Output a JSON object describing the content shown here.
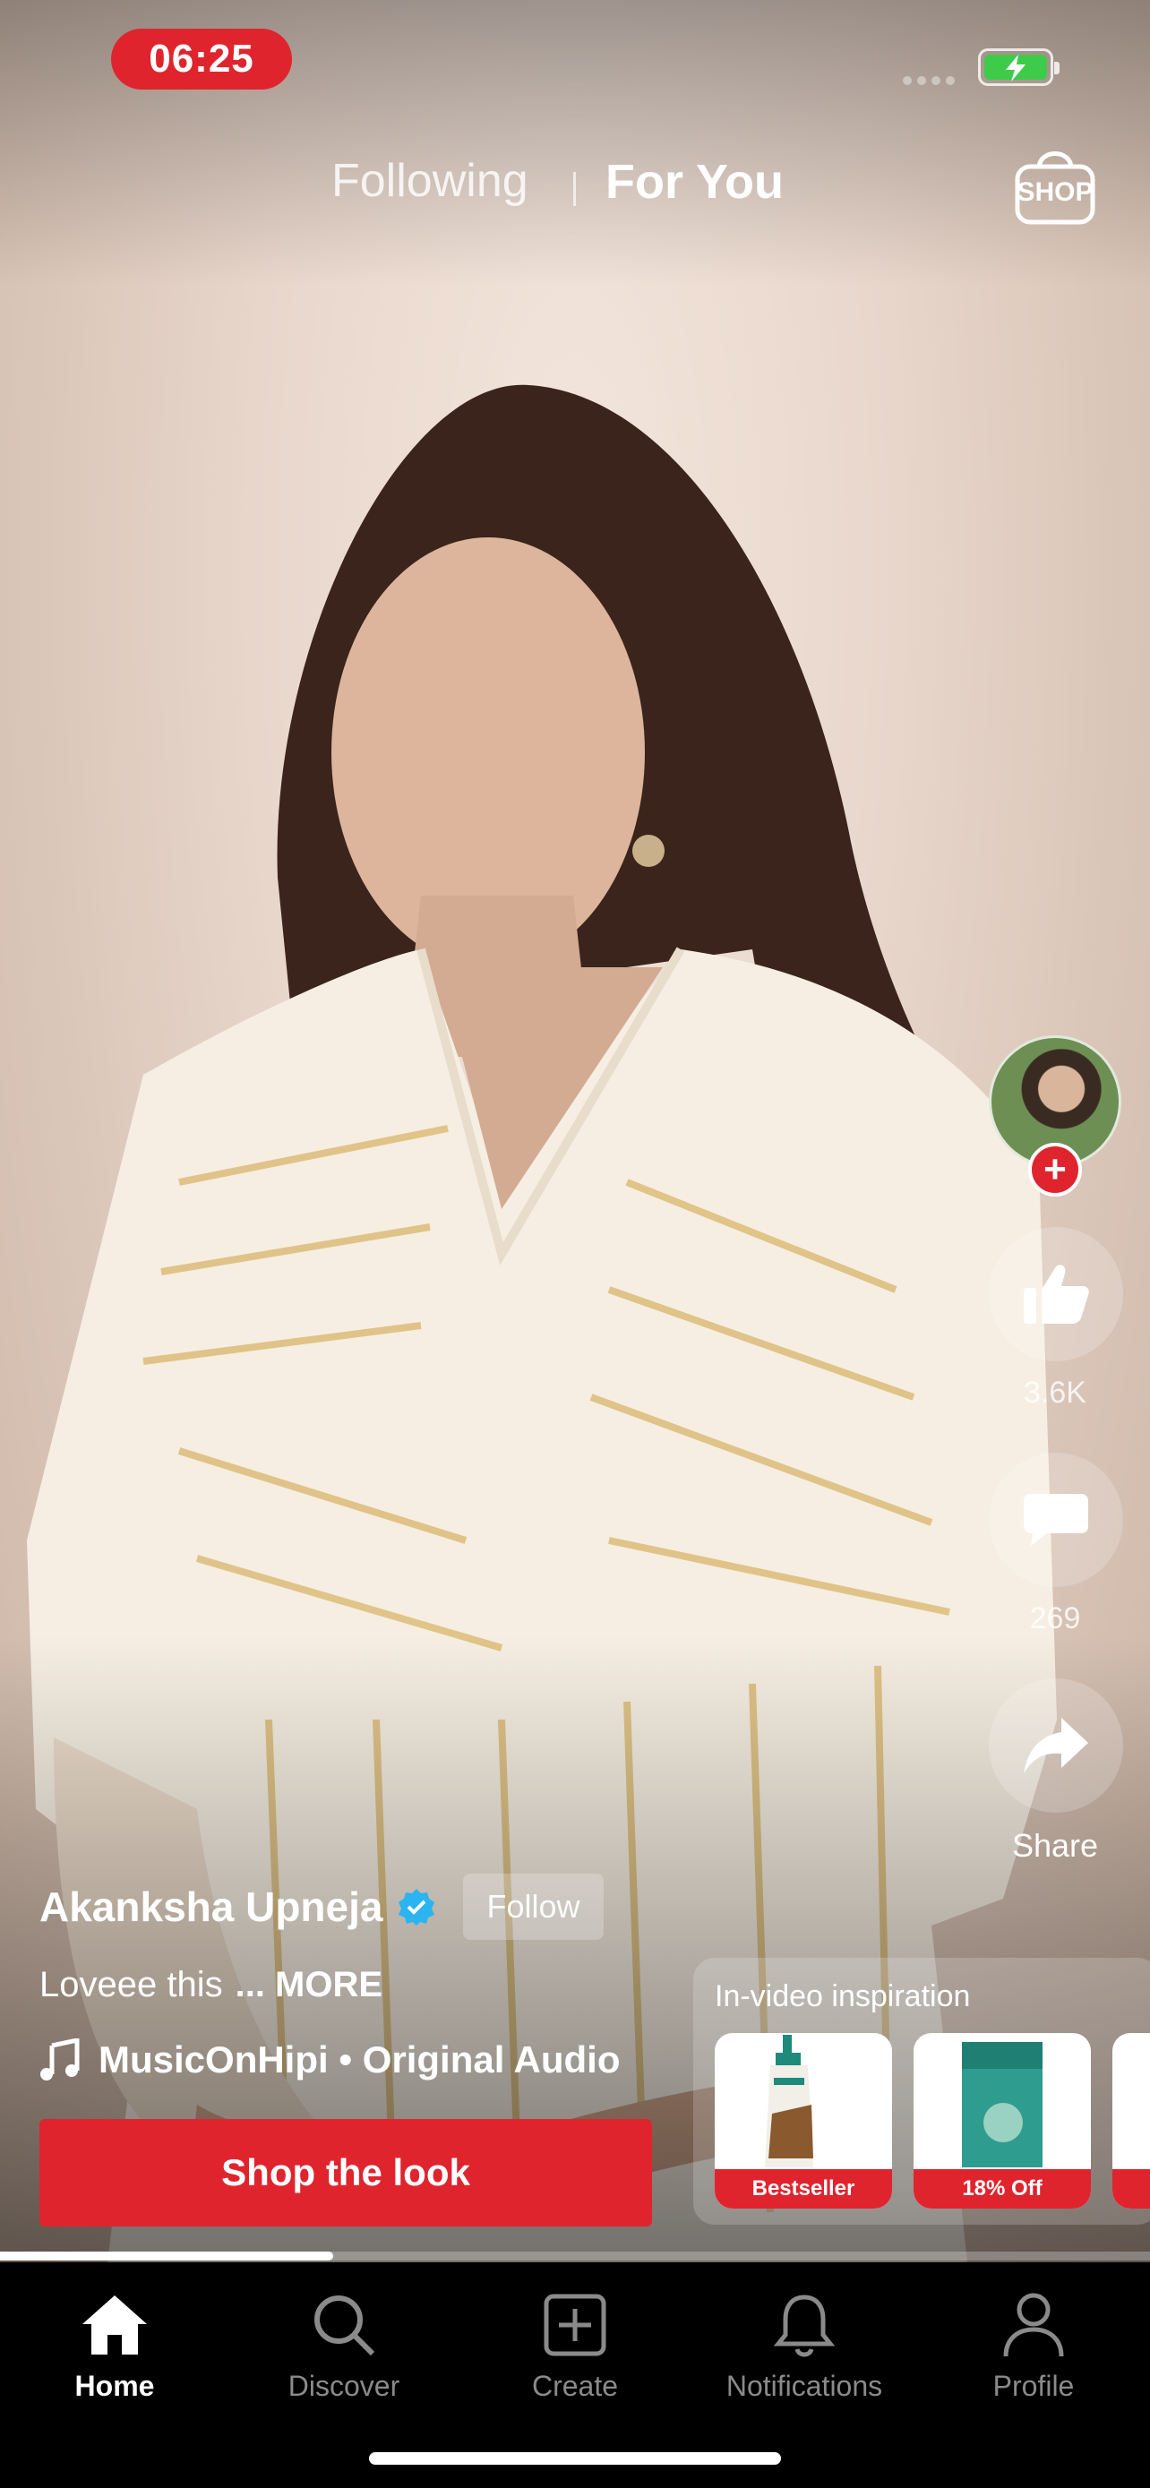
{
  "status_bar": {
    "time": "06:25"
  },
  "top_nav": {
    "tabs": [
      "Following",
      "For You"
    ],
    "active_tab": "For You",
    "shop_label": "SHOP"
  },
  "right_rail": {
    "likes": "3.6K",
    "comments": "269",
    "share_label": "Share"
  },
  "post": {
    "username": "Akanksha Upneja",
    "verified": true,
    "follow_label": "Follow",
    "caption": "Loveee this",
    "more_label": "... MORE",
    "audio": "MusicOnHipi • Original Audio",
    "shop_button": "Shop the look"
  },
  "inspiration": {
    "title": "In-video inspiration",
    "products": [
      {
        "badge": "Bestseller"
      },
      {
        "badge": "18% Off"
      }
    ]
  },
  "video_progress": 0.29,
  "bottom_nav": {
    "items": [
      {
        "label": "Home",
        "icon": "home-icon",
        "active": true
      },
      {
        "label": "Discover",
        "icon": "search-icon",
        "active": false
      },
      {
        "label": "Create",
        "icon": "plus-square-icon",
        "active": false
      },
      {
        "label": "Notifications",
        "icon": "bell-icon",
        "active": false
      },
      {
        "label": "Profile",
        "icon": "user-icon",
        "active": false
      }
    ]
  },
  "colors": {
    "accent": "#e0242e",
    "verified": "#2ab4f0",
    "battery": "#3fcb4a"
  }
}
